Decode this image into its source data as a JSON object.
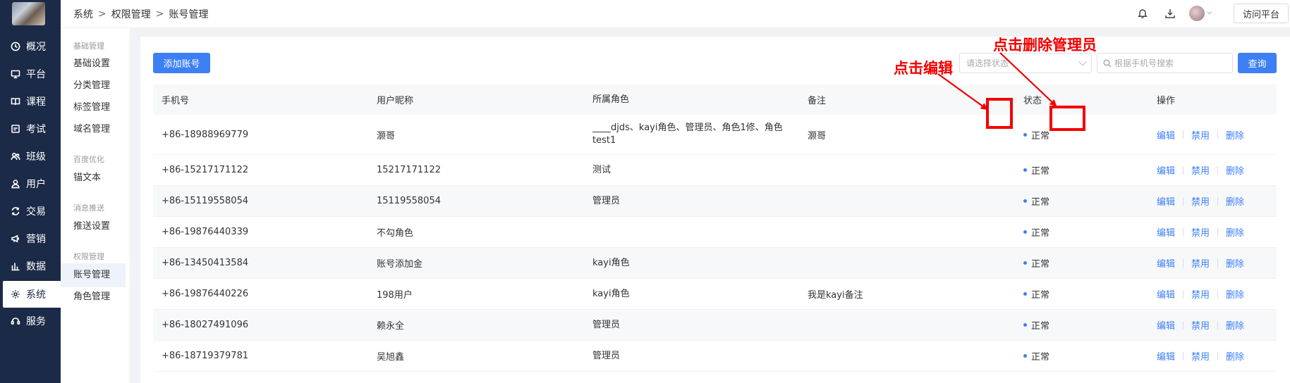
{
  "nav": {
    "items": [
      {
        "label": "概况",
        "icon": "clock-icon"
      },
      {
        "label": "平台",
        "icon": "monitor-icon"
      },
      {
        "label": "课程",
        "icon": "book-icon"
      },
      {
        "label": "考试",
        "icon": "exam-icon"
      },
      {
        "label": "班级",
        "icon": "group-icon"
      },
      {
        "label": "用户",
        "icon": "user-icon"
      },
      {
        "label": "交易",
        "icon": "exchange-icon"
      },
      {
        "label": "营销",
        "icon": "megaphone-icon"
      },
      {
        "label": "数据",
        "icon": "bar-chart-icon"
      },
      {
        "label": "系统",
        "icon": "gear-icon"
      },
      {
        "label": "服务",
        "icon": "service-icon"
      }
    ],
    "active": "系统"
  },
  "subnav": {
    "groups": [
      {
        "title": "基础管理",
        "items": [
          "基础设置",
          "分类管理",
          "标签管理",
          "域名管理"
        ]
      },
      {
        "title": "百度优化",
        "items": [
          "锚文本"
        ]
      },
      {
        "title": "消息推送",
        "items": [
          "推送设置"
        ]
      },
      {
        "title": "权限管理",
        "items": [
          "账号管理",
          "角色管理"
        ]
      }
    ],
    "active": "账号管理"
  },
  "header": {
    "breadcrumb": [
      "系统",
      "权限管理",
      "账号管理"
    ],
    "icons": [
      "bell-icon",
      "download-icon"
    ],
    "visit_label": "访问平台"
  },
  "toolbar": {
    "add_label": "添加账号",
    "status_placeholder": "请选择状态",
    "search_placeholder": "根据手机号搜索",
    "query_label": "查询"
  },
  "table": {
    "columns": [
      "手机号",
      "用户昵称",
      "所属角色",
      "备注",
      "状态",
      "操作"
    ],
    "rows": [
      {
        "phone": "+86-18988969779",
        "nickname": "灏哥",
        "role": "____djds、kayi角色、管理员、角色1修、角色test1",
        "note": "灏哥",
        "status": "正常"
      },
      {
        "phone": "+86-15217171122",
        "nickname": "15217171122",
        "role": "测试",
        "note": "",
        "status": "正常"
      },
      {
        "phone": "+86-15119558054",
        "nickname": "15119558054",
        "role": "管理员",
        "note": "",
        "status": "正常"
      },
      {
        "phone": "+86-19876440339",
        "nickname": "不勾角色",
        "role": "",
        "note": "",
        "status": "正常"
      },
      {
        "phone": "+86-13450413584",
        "nickname": "账号添加金",
        "role": "kayi角色",
        "note": "",
        "status": "正常"
      },
      {
        "phone": "+86-19876440226",
        "nickname": "198用户",
        "role": "kayi角色",
        "note": "我是kayi备注",
        "status": "正常"
      },
      {
        "phone": "+86-18027491096",
        "nickname": "赖永全",
        "role": "管理员",
        "note": "",
        "status": "正常"
      },
      {
        "phone": "+86-18719379781",
        "nickname": "吴旭鑫",
        "role": "管理员",
        "note": "",
        "status": "正常"
      }
    ],
    "ops": {
      "edit": "编辑",
      "disable": "禁用",
      "delete": "删除"
    }
  },
  "annotations": {
    "edit_text": "点击编辑",
    "delete_text": "点击删除管理员",
    "color": "#f20000"
  }
}
